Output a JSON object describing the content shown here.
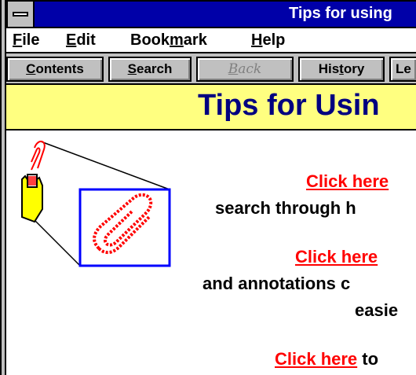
{
  "window": {
    "title": "Tips for using"
  },
  "menu": {
    "file": {
      "underline": "F",
      "rest": "ile"
    },
    "edit": {
      "underline": "E",
      "rest": "dit"
    },
    "bookmark": {
      "before": "Book",
      "underline": "m",
      "after": "ark"
    },
    "help": {
      "underline": "H",
      "rest": "elp"
    }
  },
  "buttons": {
    "contents": {
      "underline": "C",
      "rest": "ontents"
    },
    "search": {
      "underline": "S",
      "rest": "earch"
    },
    "back": {
      "underline": "B",
      "rest": "ack"
    },
    "history": {
      "before": "His",
      "underline": "t",
      "after": "ory"
    },
    "next": {
      "label": "Le"
    }
  },
  "header": {
    "title": "Tips for Usin"
  },
  "content": {
    "items": [
      {
        "link": "Click here",
        "line2": "search through h"
      },
      {
        "link": "Click here",
        "line2": "and annotations c",
        "line3": "easie"
      },
      {
        "link": "Click here",
        "after": " to"
      }
    ]
  },
  "icons": {
    "hand": "hand-pointer-icon",
    "paperclip": "paperclip-icon"
  },
  "colors": {
    "titlebar": "#0000a8",
    "header_bg": "#ffff80",
    "header_text": "#000080",
    "link": "#ff0000",
    "chrome": "#c0c0c0"
  }
}
